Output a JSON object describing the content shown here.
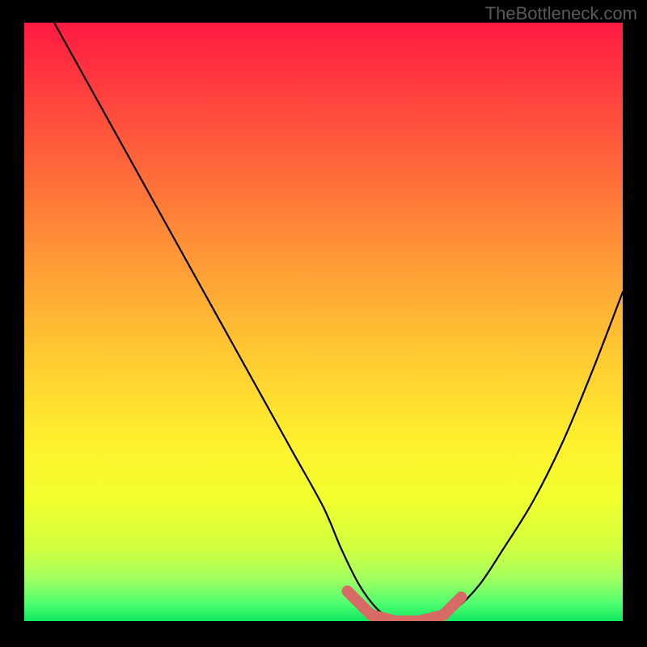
{
  "watermark": "TheBottleneck.com",
  "chart_data": {
    "type": "line",
    "title": "",
    "xlabel": "",
    "ylabel": "",
    "xlim": [
      0,
      100
    ],
    "ylim": [
      0,
      100
    ],
    "grid": false,
    "series": [
      {
        "name": "curve",
        "x": [
          5,
          10,
          15,
          20,
          25,
          30,
          35,
          40,
          45,
          50,
          53,
          56,
          59,
          62,
          65,
          68,
          72,
          76,
          80,
          85,
          90,
          95,
          100
        ],
        "y": [
          100,
          91,
          82,
          73,
          64,
          55,
          46,
          37,
          28,
          19,
          12,
          6,
          2,
          0,
          0,
          0,
          2,
          6,
          12,
          20,
          30,
          42,
          55
        ]
      }
    ],
    "highlight_points": {
      "name": "optimal-zone",
      "x": [
        54,
        58,
        62,
        66,
        70,
        73
      ],
      "y": [
        5,
        1,
        0,
        0,
        1,
        4
      ]
    },
    "gradient_stops": [
      {
        "offset": 0.0,
        "color": "#ff1a42"
      },
      {
        "offset": 0.1,
        "color": "#ff3a3f"
      },
      {
        "offset": 0.25,
        "color": "#ff6a3a"
      },
      {
        "offset": 0.4,
        "color": "#ff9a36"
      },
      {
        "offset": 0.55,
        "color": "#ffc832"
      },
      {
        "offset": 0.7,
        "color": "#fff02e"
      },
      {
        "offset": 0.8,
        "color": "#f0ff2e"
      },
      {
        "offset": 0.88,
        "color": "#d0ff40"
      },
      {
        "offset": 0.93,
        "color": "#a0ff60"
      },
      {
        "offset": 0.97,
        "color": "#50ff70"
      },
      {
        "offset": 1.0,
        "color": "#10e860"
      }
    ]
  }
}
